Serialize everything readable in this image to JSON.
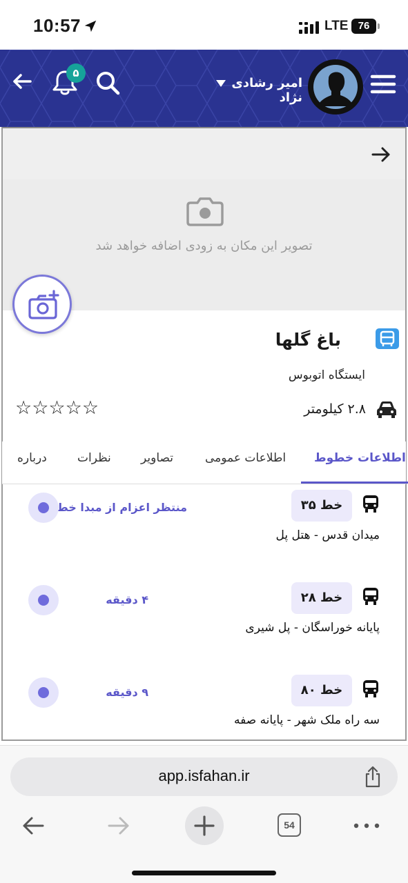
{
  "status_bar": {
    "time": "10:57",
    "network": "LTE",
    "battery": "76"
  },
  "header": {
    "user_name": "امیر رشادی نژاد",
    "notification_count": "۵",
    "colors": {
      "background": "#2a3391",
      "badge": "#16a39a"
    },
    "icons": [
      "back-arrow-icon",
      "bell-icon",
      "search-icon",
      "caret-down-icon",
      "avatar",
      "hamburger-menu-icon"
    ]
  },
  "hero": {
    "placeholder_text": "تصویر این مکان به زودی اضافه خواهد شد"
  },
  "place": {
    "title": "باغ گلها",
    "type": "ایستگاه اتوبوس",
    "rating_stars": "☆☆☆☆☆",
    "rating": 0,
    "distance": "۲.۸  کیلومتر"
  },
  "tabs": [
    {
      "label": "اطلاعات خطوط",
      "active": true
    },
    {
      "label": "اطلاعات عمومی",
      "active": false
    },
    {
      "label": "تصاویر",
      "active": false
    },
    {
      "label": "نظرات",
      "active": false
    },
    {
      "label": "درباره",
      "active": false
    }
  ],
  "lines": [
    {
      "line": "خط ۳۵",
      "route": "میدان قدس - هتل پل",
      "status": "منتظر اعزام از مبدا خط"
    },
    {
      "line": "خط ۲۸",
      "route": "پایانه خوراسگان - پل شیری",
      "status": "۴ دقیقه"
    },
    {
      "line": "خط ۸۰",
      "route": "سه راه ملک شهر - پایانه صفه",
      "status": "۹ دقیقه"
    }
  ],
  "browser": {
    "url": "app.isfahan.ir",
    "tab_count": "54"
  },
  "accent_color": "#5b57c9"
}
